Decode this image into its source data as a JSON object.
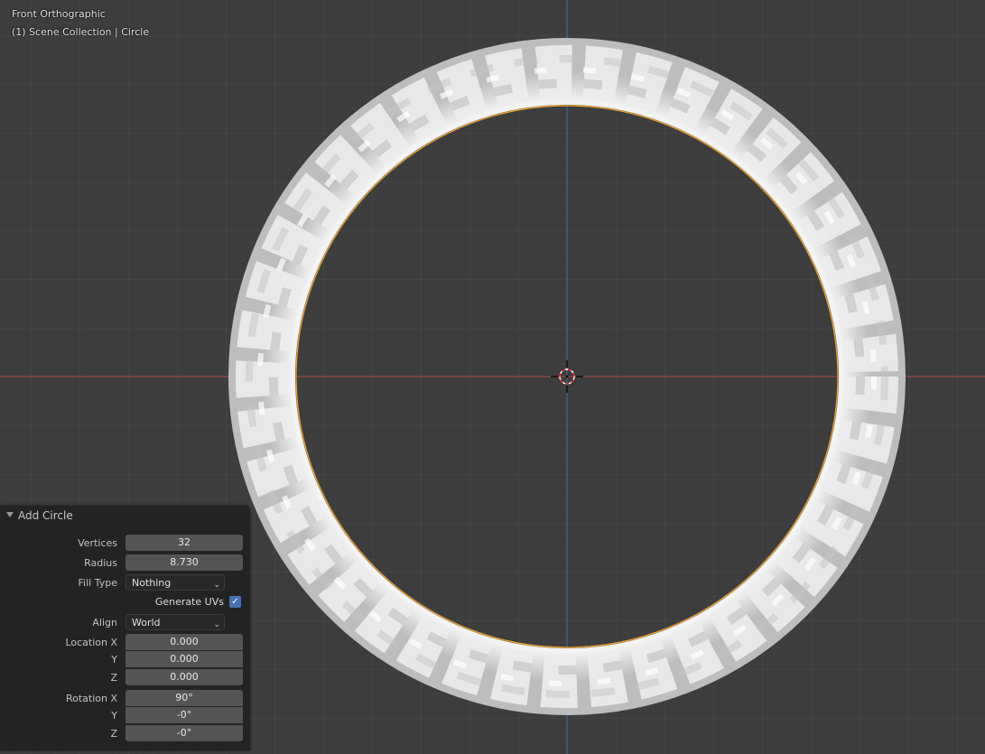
{
  "viewport": {
    "view_name": "Front Orthographic",
    "collection_info": "(1) Scene Collection | Circle"
  },
  "operator_panel": {
    "title": "Add Circle",
    "vertices_label": "Vertices",
    "vertices_value": "32",
    "radius_label": "Radius",
    "radius_value": "8.730",
    "fill_type_label": "Fill Type",
    "fill_type_value": "Nothing",
    "generate_uvs_label": "Generate UVs",
    "generate_uvs_checked": true,
    "align_label": "Align",
    "align_value": "World",
    "location_x_label": "Location X",
    "location_x_value": "0.000",
    "location_y_label": "Y",
    "location_y_value": "0.000",
    "location_z_label": "Z",
    "location_z_value": "0.000",
    "rotation_x_label": "Rotation X",
    "rotation_x_value": "90°",
    "rotation_y_label": "Y",
    "rotation_y_value": "-0°",
    "rotation_z_label": "Z",
    "rotation_z_value": "-0°"
  },
  "colors": {
    "background": "#3d3d3d",
    "x_axis": "#b24a4a",
    "z_axis": "#3e6f9e",
    "selection_outline": "#e8a030",
    "checkbox_accent": "#4772b3"
  }
}
